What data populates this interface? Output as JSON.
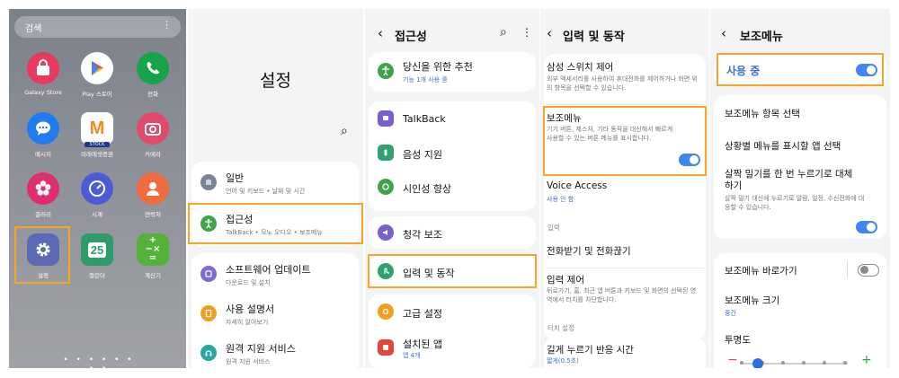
{
  "home": {
    "search_placeholder": "검색",
    "more_icon": "⋮",
    "pager": "• • • • • • • •",
    "apps": [
      {
        "label": "Galaxy Store",
        "icon": "shopping-bag-icon",
        "color": "#e83a5e"
      },
      {
        "label": "Play 스토어",
        "icon": "play-store-icon",
        "color": "#ffffff"
      },
      {
        "label": "전화",
        "icon": "phone-icon",
        "color": "#16a34a"
      },
      {
        "label": "메시지",
        "icon": "message-icon",
        "color": "#1f7cf0"
      },
      {
        "label": "미래에셋증권",
        "icon": "mirae-asset-icon",
        "color": "#ffffff"
      },
      {
        "label": "카메라",
        "icon": "camera-icon",
        "color": "#e24a6d"
      },
      {
        "label": "갤러리",
        "icon": "gallery-flower-icon",
        "color": "#df2f6f"
      },
      {
        "label": "시계",
        "icon": "clock-icon",
        "color": "#4c5bd6"
      },
      {
        "label": "연락처",
        "icon": "contacts-icon",
        "color": "#f06b3d"
      },
      {
        "label": "설정",
        "icon": "settings-gear-icon",
        "color": "#5b6ab5"
      },
      {
        "label": "캘린더",
        "icon": "calendar-icon",
        "color": "#2f9a6a",
        "day": "25"
      },
      {
        "label": "계산기",
        "icon": "calculator-icon",
        "color": "#56b13a"
      }
    ],
    "mirae_letter": "M",
    "mirae_badge": "STOCK",
    "calc_symbols": "+−×="
  },
  "settings": {
    "title": "설정",
    "search_icon": "⌕",
    "items": [
      {
        "title": "일반",
        "sub": "언어 및 키보드 • 날짜 및 시간",
        "icon": "general-icon",
        "color": "#7a8396"
      },
      {
        "title": "접근성",
        "sub": "TalkBack • 모노 오디오 • 보조메뉴",
        "icon": "accessibility-icon",
        "color": "#3fa34d"
      },
      {
        "title": "소프트웨어 업데이트",
        "sub": "다운로드 및 설치",
        "icon": "software-update-icon",
        "color": "#7b6ad6"
      },
      {
        "title": "사용 설명서",
        "sub": "자세히 알아보기",
        "icon": "manual-icon",
        "color": "#f0a020"
      },
      {
        "title": "원격 지원 서비스",
        "sub": "원격 지원 서비스",
        "icon": "remote-support-icon",
        "color": "#2aa6a0"
      }
    ]
  },
  "accessibility": {
    "back": "‹",
    "title": "접근성",
    "search_icon": "⌕",
    "more_icon": "⋮",
    "recommend_title": "당신을 위한 추천",
    "recommend_sub": "기능 1개 사용 중",
    "items": [
      {
        "title": "TalkBack",
        "icon": "talkback-icon",
        "color": "#7b5fd1"
      },
      {
        "title": "음성 지원",
        "icon": "voice-support-icon",
        "color": "#2ea36f"
      },
      {
        "title": "시인성 향상",
        "icon": "visibility-icon",
        "color": "#3fa34d"
      },
      {
        "title": "청각 보조",
        "icon": "hearing-icon",
        "color": "#7b5fd1"
      },
      {
        "title": "입력 및 동작",
        "icon": "input-interaction-icon",
        "color": "#2ea36f"
      },
      {
        "title": "고급 설정",
        "icon": "advanced-settings-icon",
        "color": "#f0a020"
      },
      {
        "title": "설치된 앱",
        "sub": "앱 4개",
        "icon": "installed-apps-icon",
        "color": "#e0483a"
      }
    ]
  },
  "input": {
    "back": "‹",
    "title": "입력 및 동작",
    "switch_title": "삼성 스위치 제어",
    "switch_desc": "외부 액세서리를 사용하여 휴대전화를 제어하거나 화면 위의 항목을 선택할 수 있습니다.",
    "assist_title": "보조메뉴",
    "assist_desc": "기기 버튼, 제스처, 기타 동작을 대신해서 빠르게 사용할 수 있는 버튼 메뉴를 표시합니다.",
    "voice_title": "Voice Access",
    "voice_sub": "사용 안 함",
    "section_input": "입력",
    "call_title": "전화받기 및 전화끊기",
    "input_control_title": "입력 제어",
    "input_control_desc": "뒤로가기, 홈, 최근 앱 버튼과 키보드 및 화면의 선택된 영역에서 터치를 차단합니다.",
    "section_touch": "터치 설정",
    "long_press_title": "길게 누르기 반응 시간",
    "long_press_sub": "짧게(0.5초)"
  },
  "assistant": {
    "back": "‹",
    "title": "보조메뉴",
    "in_use": "사용 중",
    "items_select": "보조메뉴 항목 선택",
    "apps_select": "상황별 메뉴를 표시할 앱 선택",
    "tap_title": "살짝 밀기를 한 번 누르기로 대체하기",
    "tap_desc": "살짝 밀기 대신에 누르기로 알람, 일정, 수신전화에 대응할 수 있습니다.",
    "shortcut": "보조메뉴 바로가기",
    "size_title": "보조메뉴 크기",
    "size_sub": "중간",
    "opacity": "투명도",
    "minus": "−",
    "plus": "+",
    "opacity_level": 0.17
  },
  "colors": {
    "highlight": "#f5a623",
    "toggle_on": "#3e86f0",
    "link_blue": "#3b6fd1"
  }
}
